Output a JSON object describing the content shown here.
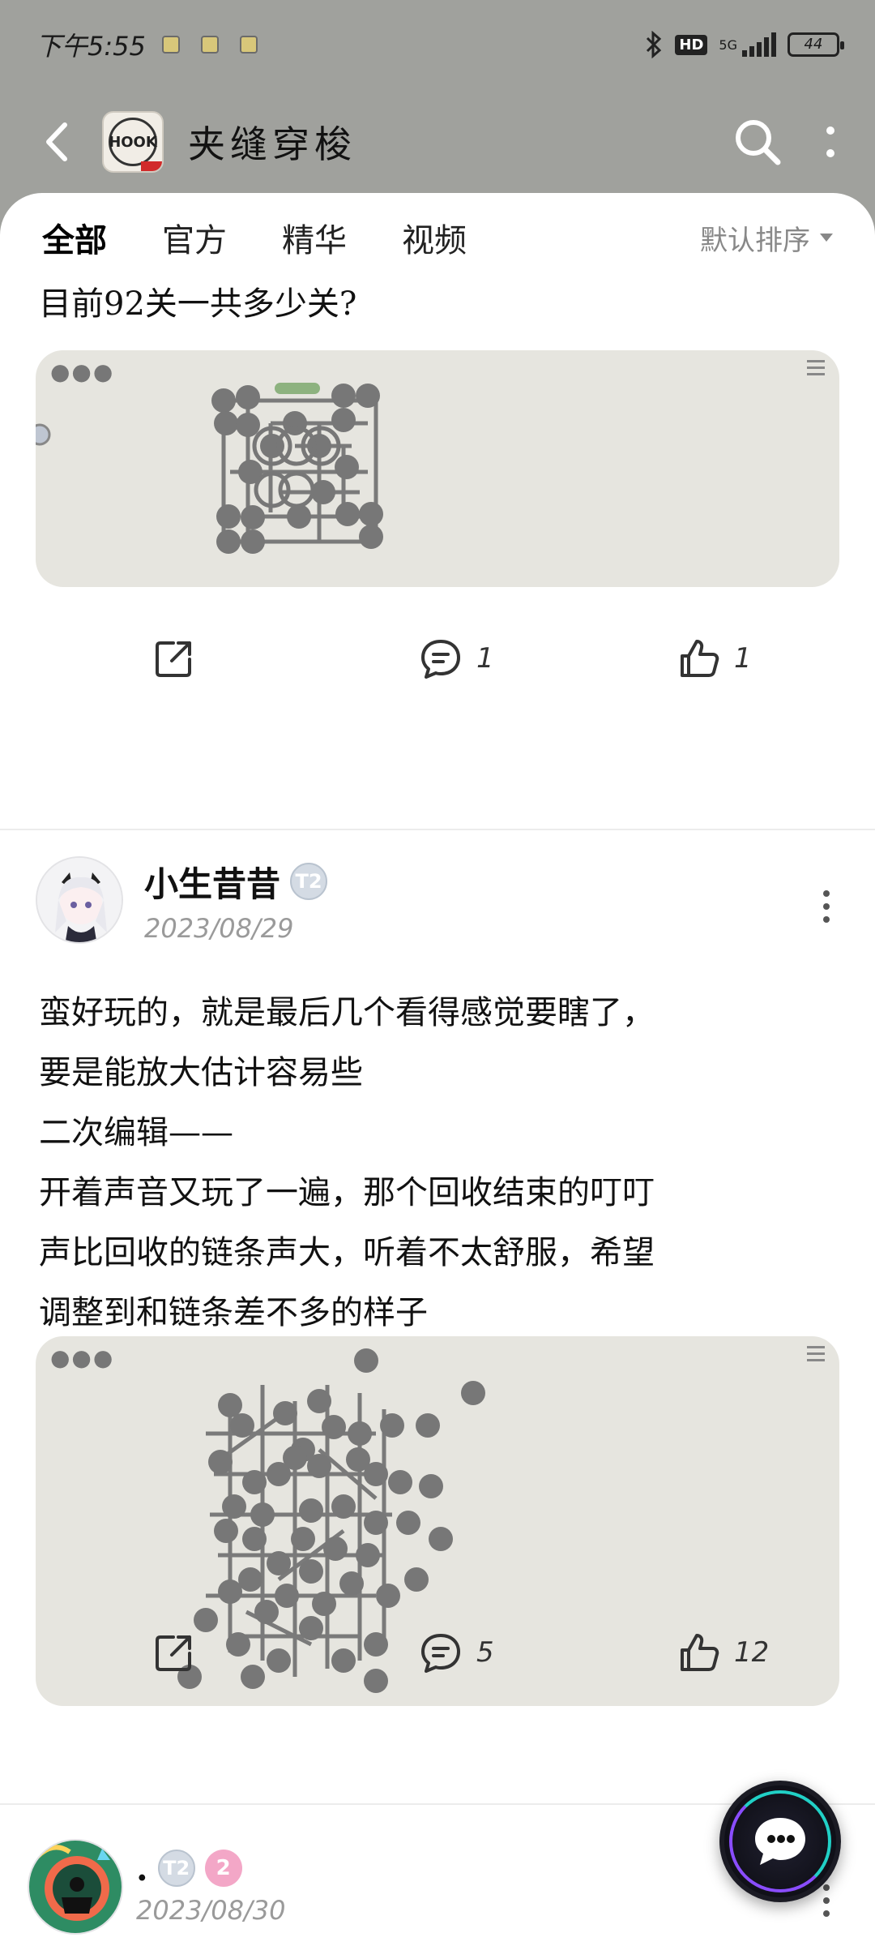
{
  "status_bar": {
    "time": "下午5:55",
    "network": "5G",
    "hd": "HD",
    "battery": "44"
  },
  "app_bar": {
    "title": "夹缝穿梭",
    "logo_text": "HOOK"
  },
  "tabs": [
    {
      "label": "全部",
      "active": true
    },
    {
      "label": "官方",
      "active": false
    },
    {
      "label": "精华",
      "active": false
    },
    {
      "label": "视频",
      "active": false
    }
  ],
  "sort_label": "默认排序",
  "posts": [
    {
      "text_lines": [
        "目前92关一共多少关?"
      ],
      "image_alt": "game-level-screenshot",
      "actions": {
        "share": "",
        "comments": "1",
        "likes": "1"
      }
    },
    {
      "author": {
        "name": "小生昔昔",
        "badge": "T2",
        "date": "2023/08/29"
      },
      "text_lines": [
        "蛮好玩的，就是最后几个看得感觉要瞎了，",
        "要是能放大估计容易些",
        "二次编辑——",
        "开着声音又玩了一遍，那个回收结束的叮叮",
        "声比回收的链条声大，听着不太舒服，希望",
        "调整到和链条差不多的样子"
      ],
      "image_alt": "game-level-screenshot",
      "actions": {
        "share": "",
        "comments": "5",
        "likes": "12"
      }
    },
    {
      "author": {
        "name": ".",
        "badge": "T2",
        "level": "2",
        "date": "2023/08/30"
      }
    }
  ],
  "colors": {
    "accent": "#22c7b8",
    "header_bg": "#a0a19d",
    "card_bg": "#e6e5df",
    "node": "#777777"
  }
}
